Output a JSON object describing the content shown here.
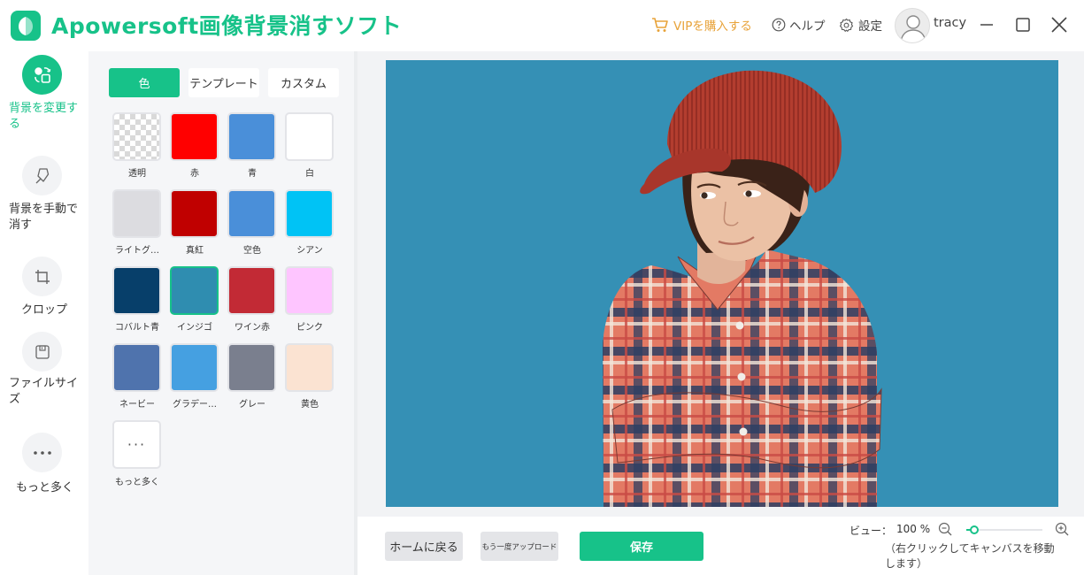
{
  "app": {
    "title": "Apowersoft画像背景消すソフト",
    "vip_label": "VIPを購入する",
    "help_label": "ヘルプ",
    "settings_label": "設定",
    "username": "tracy"
  },
  "nav": {
    "items": [
      {
        "label": "背景を変更する",
        "icon": "change-background-icon",
        "active": true
      },
      {
        "label": "背景を手動で消す",
        "icon": "manual-erase-icon",
        "active": false
      },
      {
        "label": "クロップ",
        "icon": "crop-icon",
        "active": false
      },
      {
        "label": "ファイルサイズ",
        "icon": "file-size-icon",
        "active": false
      },
      {
        "label": "もっと多く",
        "icon": "more-dots-icon",
        "active": false
      }
    ]
  },
  "panel": {
    "tabs": [
      {
        "label": "色",
        "active": true
      },
      {
        "label": "テンプレート",
        "active": false
      },
      {
        "label": "カスタム",
        "active": false
      }
    ],
    "swatches": [
      {
        "label": "透明",
        "color": "transparent"
      },
      {
        "label": "赤",
        "color": "#ff0000"
      },
      {
        "label": "青",
        "color": "#4a8fd9"
      },
      {
        "label": "白",
        "color": "#ffffff"
      },
      {
        "label": "ライトグ…",
        "color": "#dcdce0"
      },
      {
        "label": "真紅",
        "color": "#c00000"
      },
      {
        "label": "空色",
        "color": "#4a8fd9"
      },
      {
        "label": "シアン",
        "color": "#00c3f5"
      },
      {
        "label": "コバルト青",
        "color": "#073f6a"
      },
      {
        "label": "インジゴ",
        "color": "#2f8db0",
        "selected": true
      },
      {
        "label": "ワイン赤",
        "color": "#c22a35"
      },
      {
        "label": "ピンク",
        "color": "#fec5ff"
      },
      {
        "label": "ネービー",
        "color": "#4f73ad"
      },
      {
        "label": "グラデー…",
        "color": "#45a0e1"
      },
      {
        "label": "グレー",
        "color": "#7a7f8e"
      },
      {
        "label": "黄色",
        "color": "#fbe3d2"
      }
    ],
    "more_label": "もっと多く",
    "more_symbol": "···"
  },
  "canvas": {
    "background_color": "#3590b5"
  },
  "bottom": {
    "home_label": "ホームに戻る",
    "reupload_label": "もう一度アップロード",
    "save_label": "保存",
    "zoom_label": "ビュー：",
    "zoom_value": "100 %",
    "zoom_fraction": 0.1,
    "hint": "（右クリックしてキャンバスを移動します）"
  },
  "colors": {
    "accent": "#17c289",
    "vip": "#e8a33a"
  }
}
